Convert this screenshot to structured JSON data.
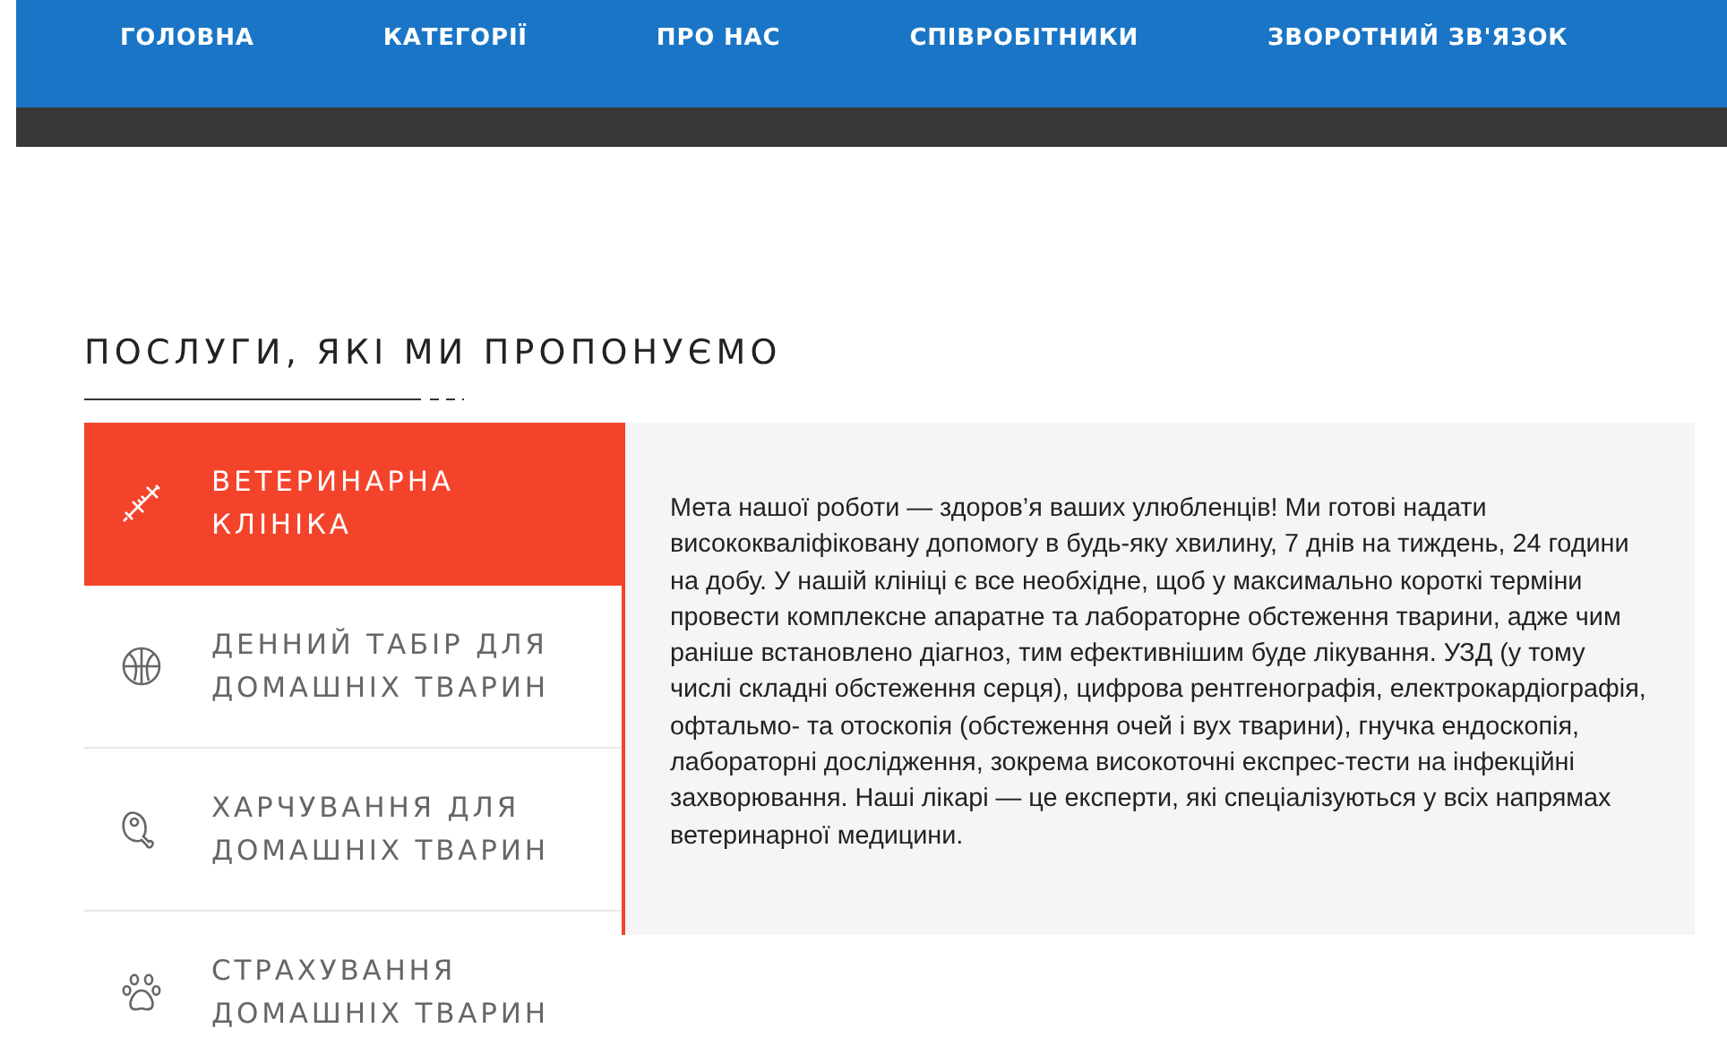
{
  "nav": [
    {
      "label": "ГОЛОВНА"
    },
    {
      "label": "КАТЕГОРІЇ"
    },
    {
      "label": "ПРО НАС"
    },
    {
      "label": "СПІВРОБІТНИКИ"
    },
    {
      "label": "ЗВОРОТНИЙ ЗВ'ЯЗОК"
    }
  ],
  "section_title": "ПОСЛУГИ, ЯКІ МИ ПРОПОНУЄМО",
  "tabs": [
    {
      "label": "ВЕТЕРИНАРНА КЛІНІКА",
      "selected": true
    },
    {
      "label": "ДЕННИЙ ТАБІР ДЛЯ ДОМАШНІХ ТВАРИН",
      "selected": false
    },
    {
      "label": "ХАРЧУВАННЯ ДЛЯ ДОМАШНІХ ТВАРИН",
      "selected": false
    },
    {
      "label": "СТРАХУВАННЯ ДОМАШНІХ ТВАРИН",
      "selected": false
    }
  ],
  "panel_text": "Мета нашої роботи — здоров’я ваших улюбленців! Ми готові надати висококваліфіковану допомогу в будь-яку хвилину, 7 днів на тиждень, 24 години на добу. У нашій клініці є все необхідне, щоб у максимально короткі терміни провести комплексне апаратне та лабораторне обстеження тварини, адже чим раніше встановлено діагноз, тим ефективнішим буде лікування. УЗД (у тому числі складні обстеження серця), цифрова рентгенографія, електрокардіографія, офтальмо- та отоскопія (обстеження очей і вух тварини), гнучка ендоскопія, лабораторні дослідження, зокрема високоточні експрес-тести на інфекційні захворювання. Наші лікарі — це експерти, які спеціалізуються у всіх напрямах ветеринарної медицини."
}
